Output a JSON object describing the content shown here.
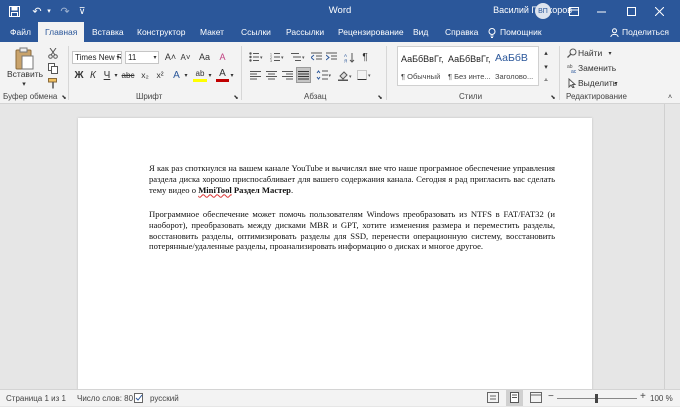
{
  "titlebar": {
    "title": "Word",
    "user": "Василий Прохоров",
    "initials": "ВП"
  },
  "tabs": [
    "Файл",
    "Главная",
    "Вставка",
    "Конструктор",
    "Макет",
    "Ссылки",
    "Рассылки",
    "Рецензирование",
    "Вид",
    "Справка",
    "Помощник",
    "Поделиться"
  ],
  "ribbon": {
    "clipboard": {
      "paste": "Вставить",
      "label": "Буфер обмена"
    },
    "font": {
      "name": "Times New R",
      "size": "11",
      "label": "Шрифт",
      "bold": "Ж",
      "italic": "К",
      "underline": "Ч",
      "strike": "abc",
      "sub": "x₂",
      "sup": "x²",
      "grow": "A˄",
      "shrink": "A˅",
      "case": "Aa",
      "clear": "A",
      "effects": "A",
      "highlight": "ab",
      "color": "A"
    },
    "paragraph": {
      "label": "Абзац"
    },
    "styles": {
      "label": "Стили",
      "items": [
        {
          "sample": "АаБбВвГг,",
          "name": "¶ Обычный"
        },
        {
          "sample": "АаБбВвГг,",
          "name": "¶ Без инте..."
        },
        {
          "sample": "АаБбВ",
          "name": "Заголово..."
        }
      ]
    },
    "editing": {
      "label": "Редактирование",
      "find": "Найти",
      "replace": "Заменить",
      "select": "Выделить"
    }
  },
  "document": {
    "p1_before": "Я как раз споткнулся на вашем канале YouTube и вычислял вне что наше програмное обеспечение управления раздела диска хорошо приспосабливает для вашего содержания канала. Сегодня я рад пригласить вас сделать тему видео о ",
    "p1_bold1": "MiniTool",
    "p1_bold2": " Раздел Мастер",
    "p1_end": ".",
    "p2": "Программное обеспечение может помочь пользователям Windows преобразовать из NTFS в FAT/FAT32 (и наоборот), преобразовать между дисками MBR и GPT, хотите изменения размера и переместить разделы, восстановить разделы, оптимизировать разделы для SSD, перенести операционную систему, восстановить потерянные/удаленные разделы, проанализировать информацию о дисках и многое другое."
  },
  "status": {
    "page": "Страница 1 из 1",
    "words": "Число слов: 80",
    "language": "русский",
    "zoom_minus": "−",
    "zoom_plus": "+",
    "zoom": "100 %"
  },
  "colors": {
    "brand": "#2b579a",
    "font_color": "#c00000",
    "highlight": "#ffff00"
  }
}
